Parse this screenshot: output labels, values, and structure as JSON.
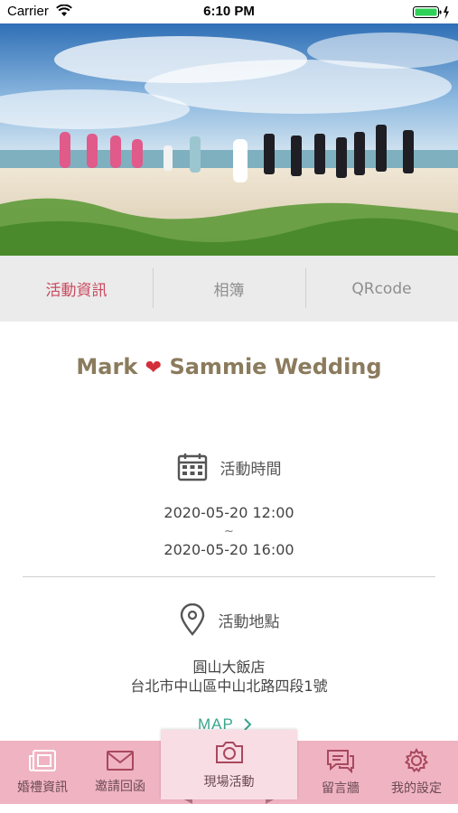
{
  "status_bar": {
    "carrier": "Carrier",
    "time": "6:10 PM"
  },
  "tabs": [
    {
      "label": "活動資訊",
      "active": true
    },
    {
      "label": "相簿",
      "active": false
    },
    {
      "label": "QRcode",
      "active": false
    }
  ],
  "event": {
    "title_left": "Mark",
    "title_right": "Sammie Wedding",
    "time_section": {
      "label": "活動時間",
      "start": "2020-05-20 12:00",
      "separator": "~",
      "end": "2020-05-20 16:00"
    },
    "place_section": {
      "label": "活動地點",
      "venue": "圓山大飯店",
      "address": "台北市中山區中山北路四段1號"
    },
    "map_label": "MAP"
  },
  "bottom_nav": {
    "items": [
      {
        "label": "婚禮資訊",
        "icon": "newspaper-icon"
      },
      {
        "label": "邀請回函",
        "icon": "envelope-icon"
      },
      {
        "label": "現場活動",
        "icon": "camera-icon"
      },
      {
        "label": "留言牆",
        "icon": "chat-bubbles-icon"
      },
      {
        "label": "我的設定",
        "icon": "gear-icon"
      }
    ]
  },
  "colors": {
    "accent": "#c94a5f",
    "title": "#8b7b5d",
    "map": "#3aa58c",
    "nav_bg": "#f0b3c2",
    "nav_center": "#f9dde4"
  }
}
